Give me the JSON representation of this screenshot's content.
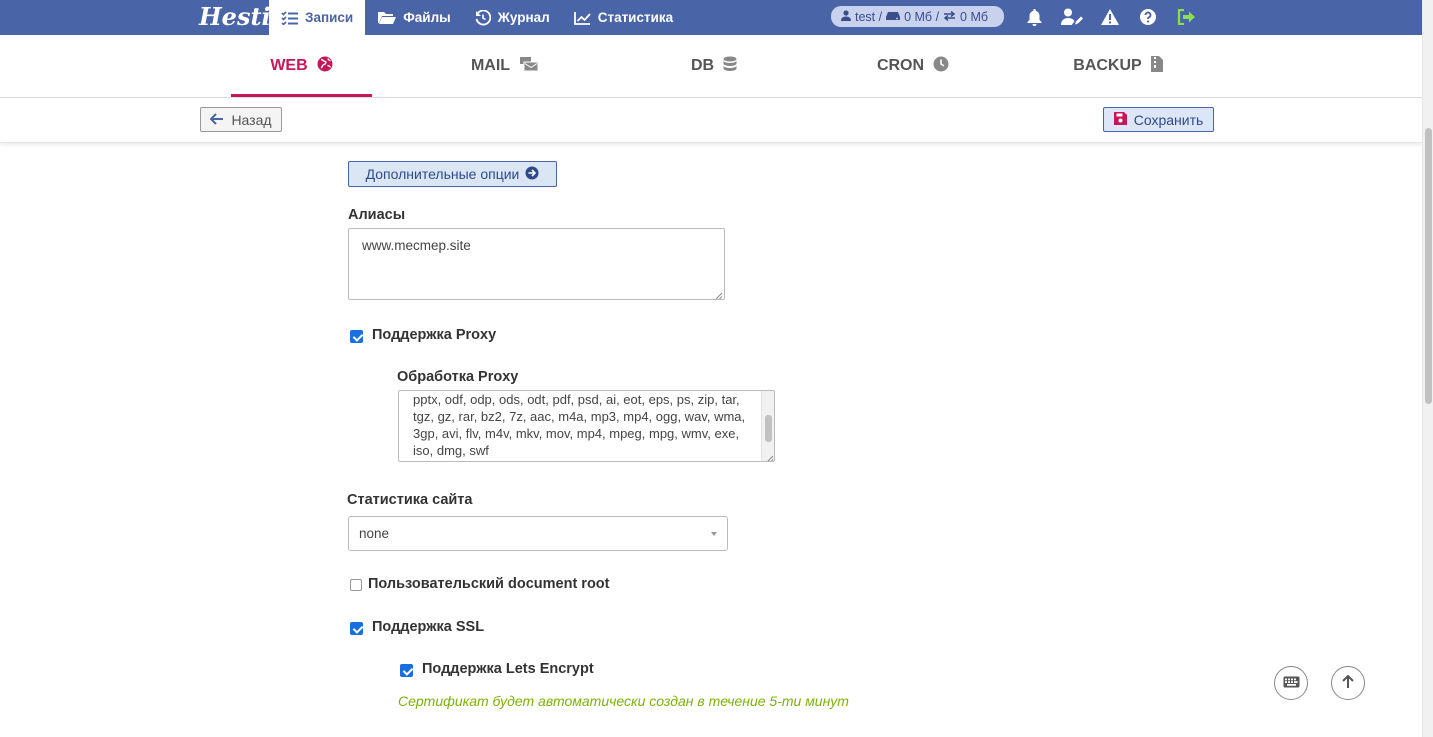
{
  "app": {
    "logo_text": "Hestia"
  },
  "topnav": {
    "items": [
      {
        "label": "Записи",
        "icon": "list-check-icon",
        "active": true
      },
      {
        "label": "Файлы",
        "icon": "folder-open-icon",
        "active": false
      },
      {
        "label": "Журнал",
        "icon": "history-icon",
        "active": false
      },
      {
        "label": "Статистика",
        "icon": "chart-line-icon",
        "active": false
      }
    ]
  },
  "user": {
    "name": "test /",
    "disk": "0 Мб /",
    "bandwidth": "0 Мб"
  },
  "top_icons": [
    "bell-icon",
    "user-edit-icon",
    "warning-icon",
    "help-icon",
    "logout-icon"
  ],
  "tabs": [
    {
      "label": "WEB",
      "icon": "globe-icon",
      "active": true
    },
    {
      "label": "MAIL",
      "icon": "mail-bulk-icon",
      "active": false
    },
    {
      "label": "DB",
      "icon": "database-icon",
      "active": false
    },
    {
      "label": "CRON",
      "icon": "clock-icon",
      "active": false
    },
    {
      "label": "BACKUP",
      "icon": "file-zip-icon",
      "active": false
    }
  ],
  "toolbar": {
    "back_label": "Назад",
    "save_label": "Сохранить"
  },
  "form": {
    "more_options_label": "Дополнительные опции",
    "aliases_label": "Алиасы",
    "aliases_value": "www.mecmep.site",
    "proxy_support_label": "Поддержка Proxy",
    "proxy_support_checked": true,
    "proxy_ext_label": "Обработка Proxy",
    "proxy_ext_lines": [
      "pptx, odf, odp, ods, odt, pdf, psd, ai, eot, eps, ps, zip, tar,",
      "tgz, gz, rar, bz2, 7z, aac, m4a, mp3, mp4, ogg, wav, wma,",
      "3gp, avi, flv, m4v, mkv, mov, mp4, mpeg, mpg, wmv, exe,",
      "iso, dmg, swf"
    ],
    "stats_label": "Статистика сайта",
    "stats_value": "none",
    "custom_docroot_label": "Пользовательский document root",
    "custom_docroot_checked": false,
    "ssl_label": "Поддержка SSL",
    "ssl_checked": true,
    "letsencrypt_label": "Поддержка Lets Encrypt",
    "letsencrypt_checked": true,
    "letsencrypt_note": "Сертификат будет автоматически создан в течение 5-ти минут"
  },
  "colors": {
    "topbar": "#4a64a8",
    "accent": "#c7175b",
    "note": "#7cb305"
  }
}
